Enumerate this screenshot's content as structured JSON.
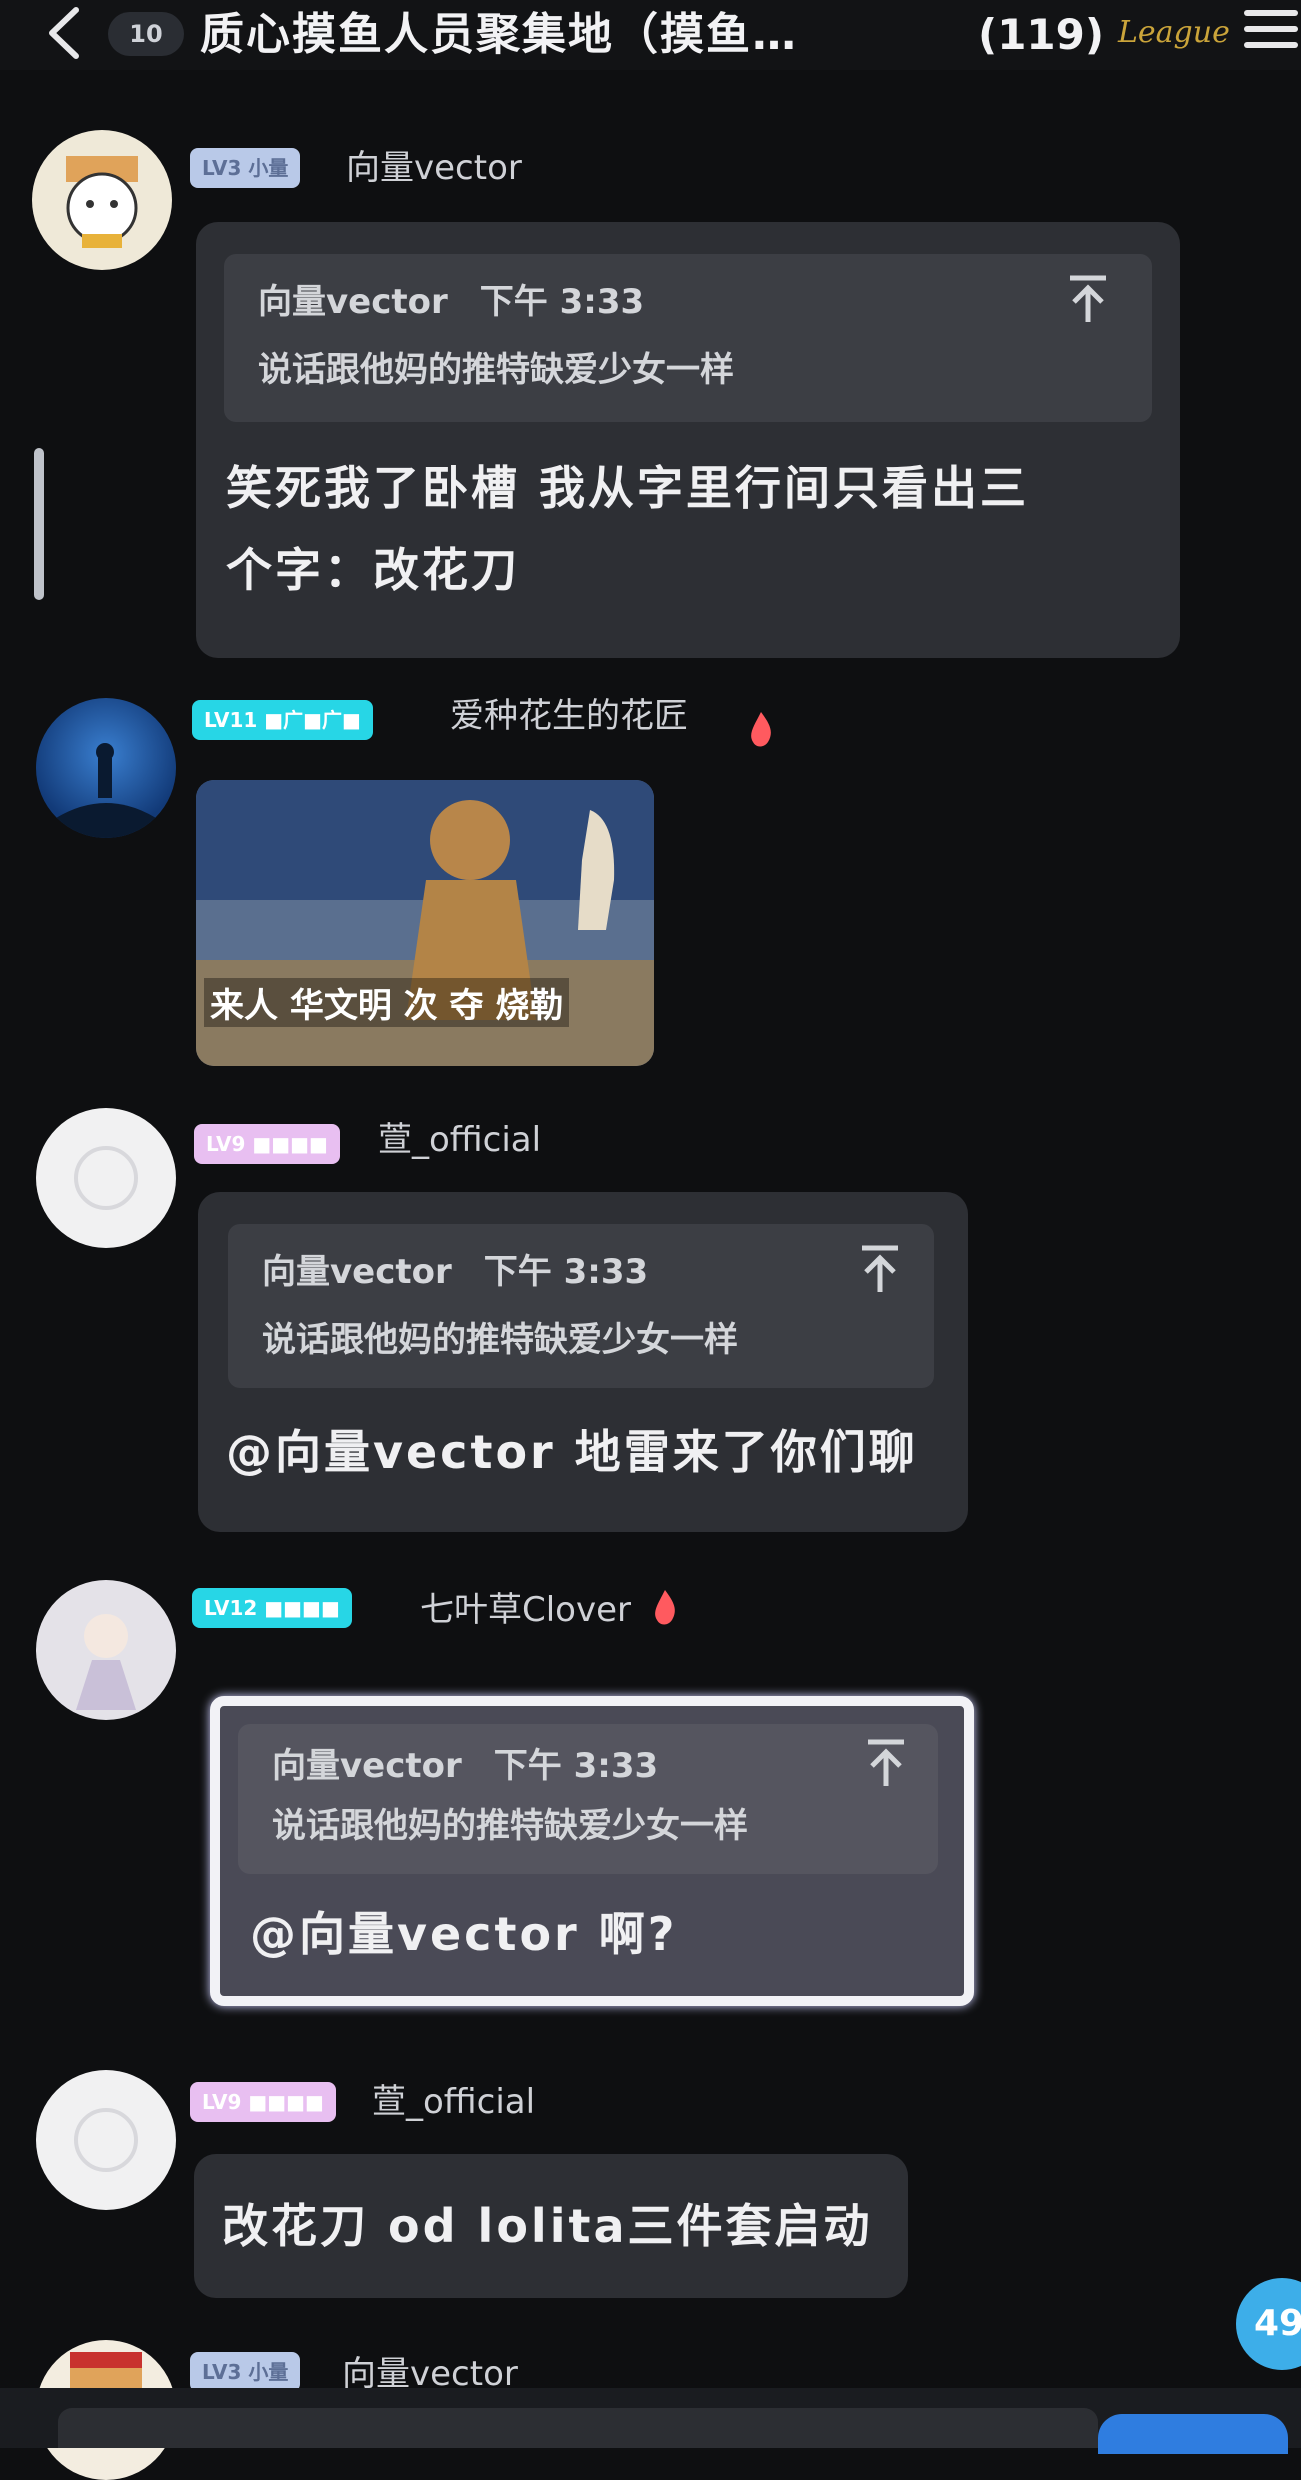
{
  "header": {
    "unread_count": "10",
    "chat_title": "质心摸鱼人员聚集地（摸鱼…",
    "member_count": "(119)",
    "league_badge": "League"
  },
  "messages": [
    {
      "level": "LV3 小量",
      "nickname": "向量vector",
      "quote": {
        "author": "向量vector",
        "time": "下午 3:33",
        "text": "说话跟他妈的推特缺爱少女一样"
      },
      "text_line1": "笑死我了卧槽 我从字里行间只看出三",
      "text_line2": "个字：改花刀"
    },
    {
      "level": "LV11 ■广■广■",
      "nickname": "爱种花生的花匠",
      "image_caption": "来人 华文明 次 夺 烧勒"
    },
    {
      "level": "LV9 ■■■■",
      "nickname": "萱_official",
      "quote": {
        "author": "向量vector",
        "time": "下午 3:33",
        "text": "说话跟他妈的推特缺爱少女一样"
      },
      "text": "@向量vector 地雷来了你们聊"
    },
    {
      "level": "LV12 ■■■■",
      "nickname": "七叶草Clover",
      "quote": {
        "author": "向量vector",
        "time": "下午 3:33",
        "text": "说话跟他妈的推特缺爱少女一样"
      },
      "text": "@向量vector 啊?"
    },
    {
      "level": "LV9 ■■■■",
      "nickname": "萱_official",
      "text": "改花刀 od lolita三件套启动"
    },
    {
      "level": "LV3 小量",
      "nickname": "向量vector"
    }
  ],
  "floating_unread": "49"
}
